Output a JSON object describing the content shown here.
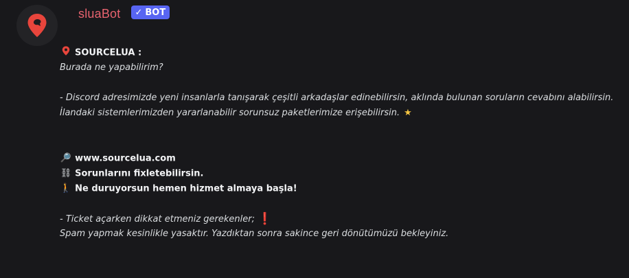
{
  "author": {
    "username": "sluaBot",
    "badge_label": "BOT",
    "badge_check": "✓",
    "avatar_icon": "map-pin-icon",
    "colors": {
      "username": "#e8636f",
      "badge": "#5865f2",
      "avatar_pin": "#e8453c"
    }
  },
  "message": {
    "heading": "SOURCELUA :",
    "heading_icon": "map-pin-icon",
    "question": "Burada ne yapabilirim?",
    "paragraph_line1": "- Discord adresimizde yeni insanlarla tanışarak çeşitli arkadaşlar edinebilirsin, aklında bulunan soruların cevabını alabilirsin.",
    "paragraph_line2": "İlandaki sistemlerimizden yararlanabilir sorunsuz paketlerimize erişebilirsin.",
    "star_icon": "★",
    "links": [
      {
        "icon": "magnifier-icon",
        "glyph": "🔎",
        "text": "www.sourcelua.com"
      },
      {
        "icon": "chains-icon",
        "glyph": "⛓",
        "text": "Sorunlarını fixletebilirsin."
      },
      {
        "icon": "person-walking-icon",
        "glyph": "🚶",
        "text": "Ne duruyorsun hemen hizmet almaya başla!"
      }
    ],
    "warning_line": "- Ticket açarken dikkat etmeniz gerekenler;",
    "warning_icon": "❗",
    "final_line": "Spam yapmak kesinlikle yasaktır. Yazdıktan sonra sakince geri dönütümüzü bekleyiniz."
  }
}
